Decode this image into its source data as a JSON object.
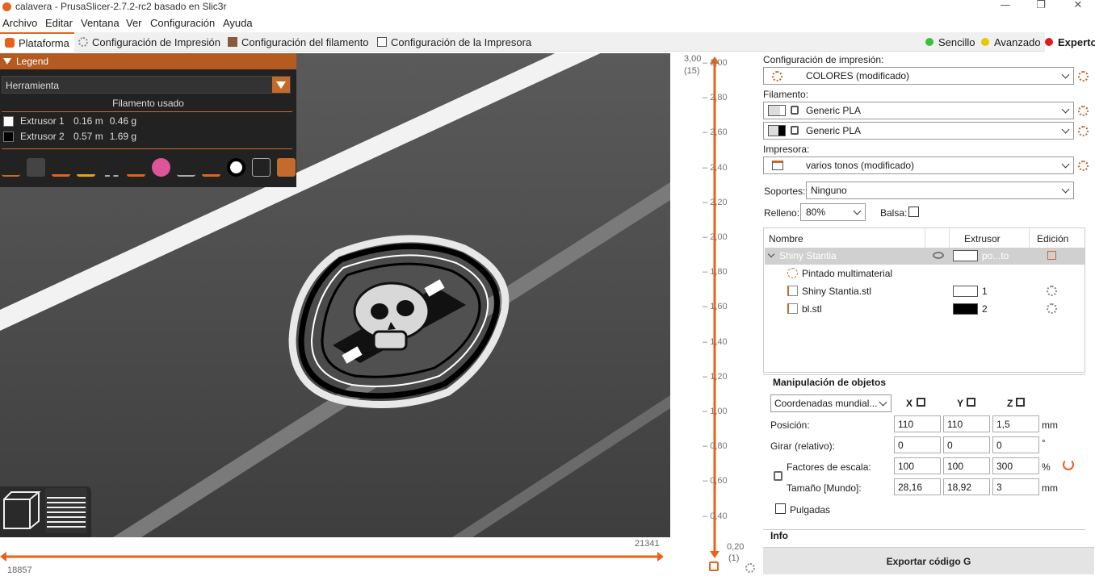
{
  "window": {
    "title": "calavera - PrusaSlicer-2.7.2-rc2 basado en Slic3r",
    "minimize": "—",
    "maximize": "❐",
    "close": "✕"
  },
  "menu": [
    "Archivo",
    "Editar",
    "Ventana",
    "Ver",
    "Configuración",
    "Ayuda"
  ],
  "tabs": [
    {
      "label": "Plataforma",
      "active": true
    },
    {
      "label": "Configuración de Impresión"
    },
    {
      "label": "Configuración del filamento"
    },
    {
      "label": "Configuración de la Impresora"
    }
  ],
  "modes": [
    {
      "label": "Sencillo",
      "color": "#3cc03c"
    },
    {
      "label": "Avanzado",
      "color": "#e6c800"
    },
    {
      "label": "Experto",
      "color": "#e01b1b"
    }
  ],
  "legend": {
    "title": "Legend",
    "view_type": "Herramienta",
    "subtitle": "Filamento usado",
    "rows": [
      {
        "name": "Extrusor 1",
        "length": "0.16 m",
        "weight": "0.46 g",
        "color": "#ffffff"
      },
      {
        "name": "Extrusor 2",
        "length": "0.57 m",
        "weight": "1.69 g",
        "color": "#000000"
      }
    ]
  },
  "hslider": {
    "left_value": "18857",
    "right_value": "21341"
  },
  "vslider": {
    "top_label": "3,00",
    "top_layer": "(15)",
    "bottom_label": "0,20",
    "bottom_layer": "(1)",
    "ticks": [
      "3,00",
      "2,80",
      "2,60",
      "2,40",
      "2,20",
      "2,00",
      "1,80",
      "1,60",
      "1,40",
      "1,20",
      "1,00",
      "0,80",
      "0,60",
      "0,40",
      "0,20"
    ]
  },
  "right": {
    "print_settings_label": "Configuración de impresión:",
    "print_settings_value": "COLORES (modificado)",
    "filament_label": "Filamento:",
    "filaments": [
      "Generic PLA",
      "Generic PLA"
    ],
    "printer_label": "Impresora:",
    "printer_value": "varios tonos (modificado)",
    "supports_label": "Soportes:",
    "supports_value": "Ninguno",
    "infill_label": "Relleno:",
    "infill_value": "80%",
    "brim_label": "Balsa:"
  },
  "objects": {
    "col_name": "Nombre",
    "col_extruder": "Extrusor",
    "col_edit": "Edición",
    "rows": [
      {
        "name": "Shiny Stantia",
        "extruder": "po...to"
      },
      {
        "name": "Pintado multimaterial"
      },
      {
        "name": "Shiny Stantia.stl",
        "extruder": "1"
      },
      {
        "name": "bl.stl",
        "extruder": "2"
      }
    ]
  },
  "manipulation": {
    "title": "Manipulación de objetos",
    "coord_mode": "Coordenadas mundial...",
    "axes": [
      "X",
      "Y",
      "Z"
    ],
    "position_label": "Posición:",
    "position": [
      "110",
      "110",
      "1,5"
    ],
    "position_unit": "mm",
    "rotate_label": "Girar (relativo):",
    "rotate": [
      "0",
      "0",
      "0"
    ],
    "rotate_unit": "°",
    "scale_label": "Factores de escala:",
    "scale": [
      "100",
      "100",
      "300"
    ],
    "scale_unit": "%",
    "size_label": "Tamaño [Mundo]:",
    "size": [
      "28,16",
      "18,92",
      "3"
    ],
    "size_unit": "mm",
    "inches_label": "Pulgadas"
  },
  "info_label": "Info",
  "export_label": "Exportar código G"
}
